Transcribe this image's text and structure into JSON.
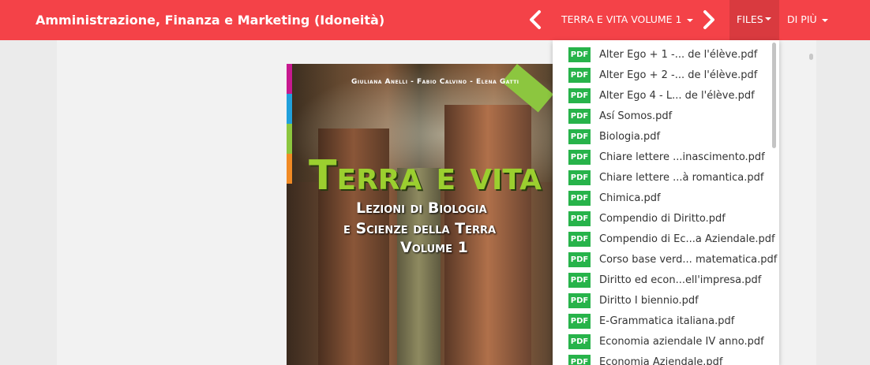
{
  "header": {
    "title": "Amministrazione, Finanza e Marketing (Idoneità)",
    "volume_label": "TERRA E VITA VOLUME 1",
    "files_label": "FILES",
    "more_label": "DI PIÙ"
  },
  "cover": {
    "authors": "Giuliana Anelli - Fabio Calvino - Elena Gatti",
    "title": "Terra e vita",
    "subtitle_1": "Lezioni di Biologia",
    "subtitle_2": "e Scienze della Terra",
    "volume": "Volume 1"
  },
  "files": {
    "badge_label": "PDF",
    "items": [
      "Alter Ego + 1 -... de l'élève.pdf",
      "Alter Ego + 2 -... de l'élève.pdf",
      "Alter Ego 4 - L... de l'élève.pdf",
      "Así Somos.pdf",
      "Biologia.pdf",
      "Chiare lettere ...inascimento.pdf",
      "Chiare lettere ...à romantica.pdf",
      "Chimica.pdf",
      "Compendio di Diritto.pdf",
      "Compendio di Ec...a Aziendale.pdf",
      "Corso base verd... matematica.pdf",
      "Diritto ed econ...ell'impresa.pdf",
      "Diritto I biennio.pdf",
      "E-Grammatica italiana.pdf",
      "Economia aziendale IV anno.pdf",
      "Economia Aziendale.pdf"
    ]
  },
  "colors": {
    "header_bg": "#f44248",
    "files_tab_bg": "#d93a3f",
    "pdf_badge": "#27b34a",
    "cover_title": "#9bcf2f"
  }
}
